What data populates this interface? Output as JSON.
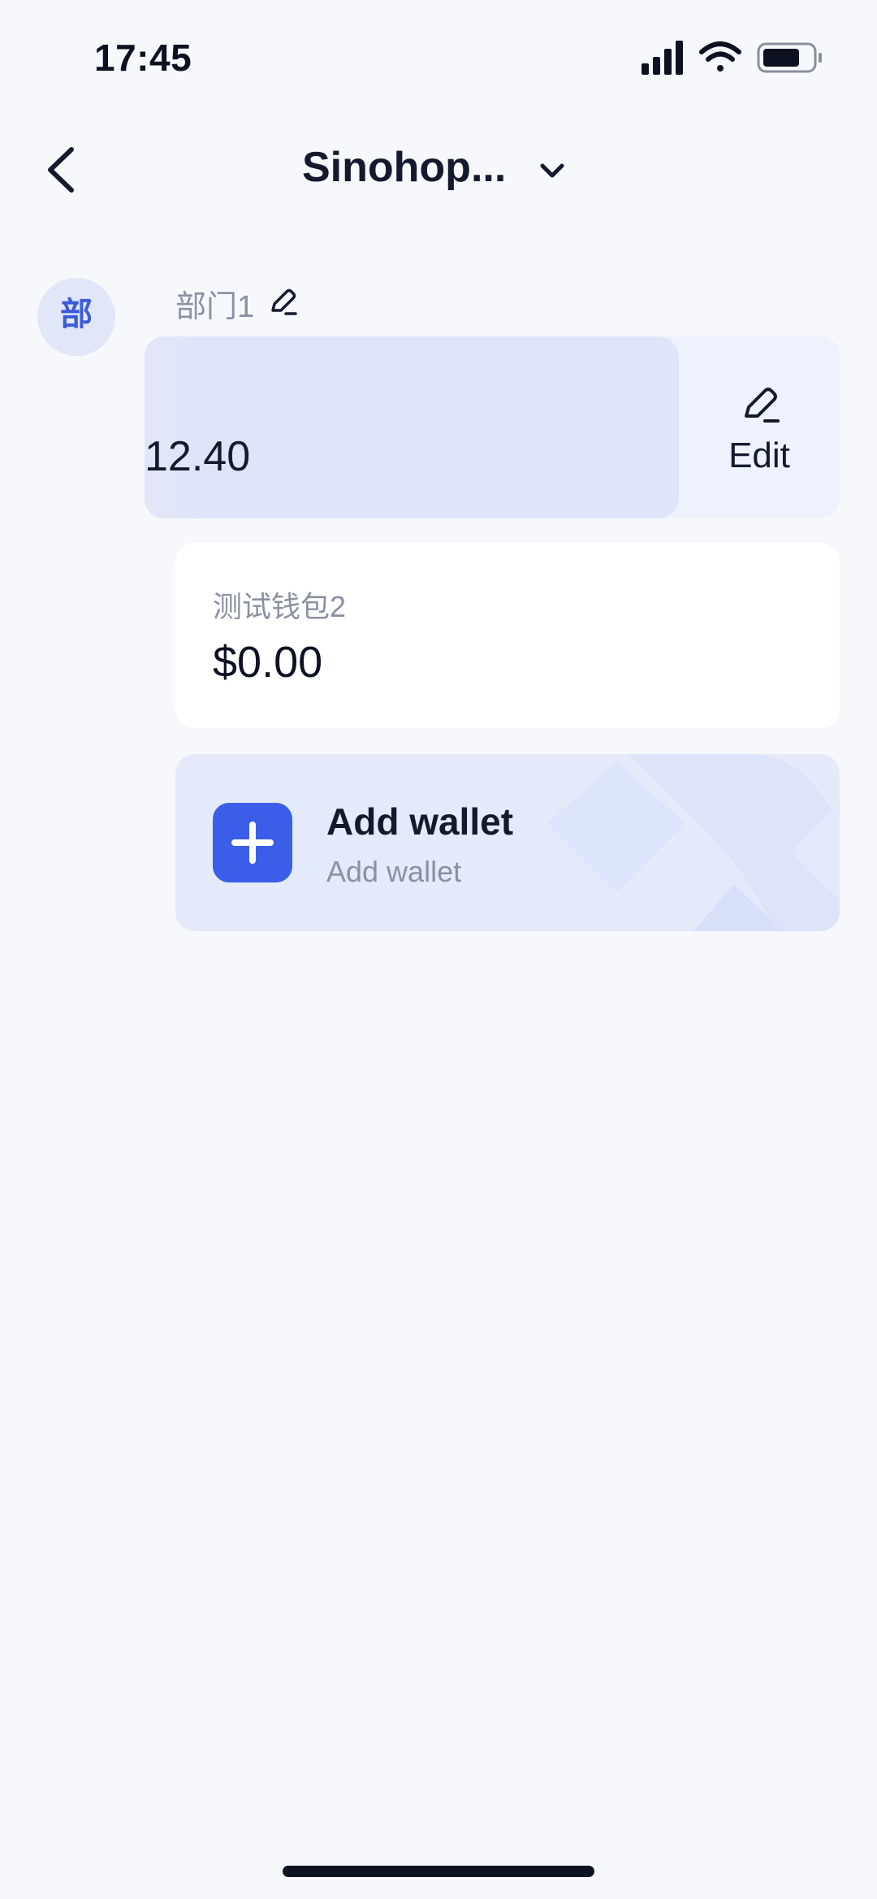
{
  "status_bar": {
    "time": "17:45",
    "icons": [
      "signal-icon",
      "wifi-icon",
      "battery-icon"
    ]
  },
  "nav": {
    "title": "Sinohop...",
    "back_icon": "chevron-left-icon",
    "dropdown_icon": "chevron-down-icon"
  },
  "department": {
    "avatar_text": "部",
    "name": "部门1",
    "edit_icon": "pencil-icon"
  },
  "swiped_wallet": {
    "amount_visible": "12.40",
    "action_label": "Edit",
    "action_icon": "pencil-icon"
  },
  "wallets": [
    {
      "name": "测试钱包2",
      "balance": "$0.00"
    }
  ],
  "add_wallet": {
    "title": "Add wallet",
    "subtitle": "Add wallet",
    "icon": "plus-icon"
  },
  "colors": {
    "background": "#f6f8fb",
    "accent": "#3a5ee8",
    "text_primary": "#141a2e",
    "text_secondary": "#8b91a3",
    "card_tint": "#e5eafb"
  }
}
